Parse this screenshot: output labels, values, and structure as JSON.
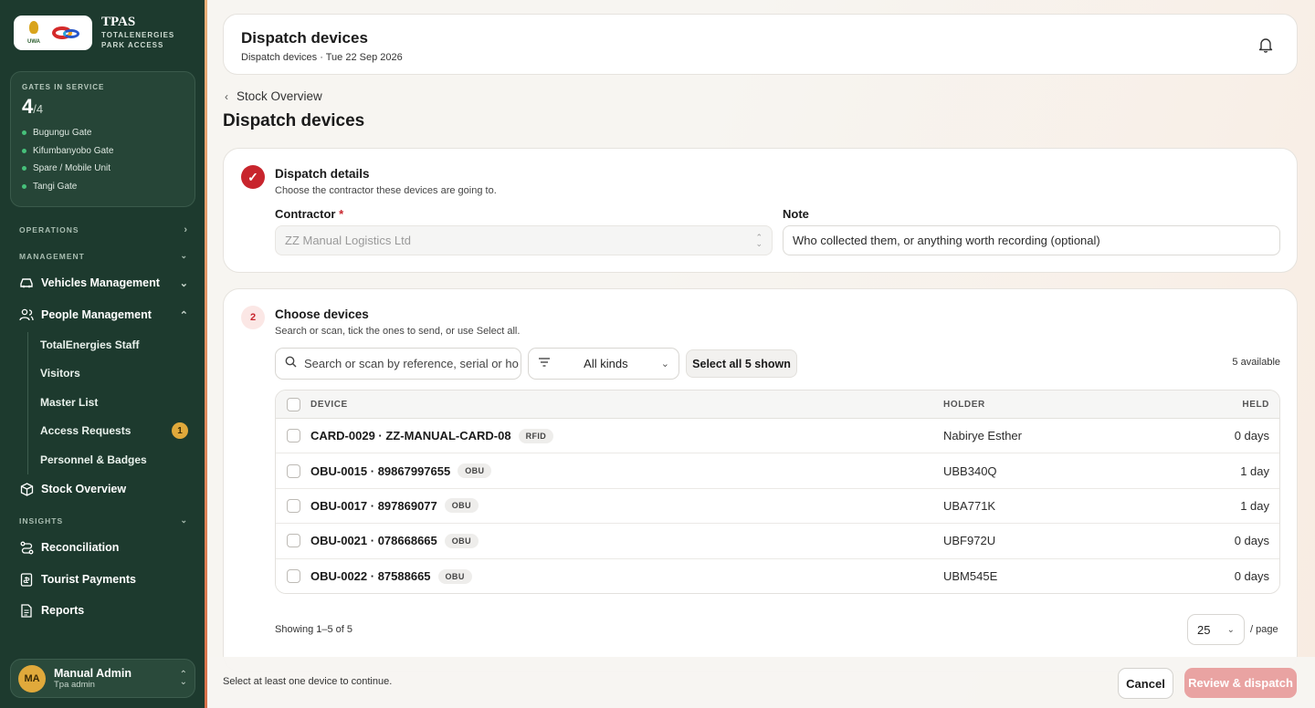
{
  "brand": {
    "title": "TPAS",
    "subtitle_line1": "TOTALENERGIES",
    "subtitle_line2": "PARK ACCESS",
    "logo_text": "UWA"
  },
  "gates": {
    "label": "GATES IN SERVICE",
    "count": "4",
    "total": "/4",
    "items": [
      "Bugungu Gate",
      "Kifumbanyobo Gate",
      "Spare / Mobile Unit",
      "Tangi Gate"
    ],
    "status_color": "#46c07a"
  },
  "nav": {
    "operations": "OPERATIONS",
    "management": "MANAGEMENT",
    "vehicles": "Vehicles Management",
    "people": "People Management",
    "people_sub": [
      "TotalEnergies Staff",
      "Visitors",
      "Master List",
      "Access Requests",
      "Personnel & Badges"
    ],
    "access_requests_badge": "1",
    "stock": "Stock Overview",
    "insights": "INSIGHTS",
    "reconciliation": "Reconciliation",
    "tourist_payments": "Tourist Payments",
    "reports": "Reports"
  },
  "user": {
    "initials": "MA",
    "name": "Manual Admin",
    "role": "Tpa admin"
  },
  "topbar": {
    "title": "Dispatch devices",
    "subtitle": "Dispatch devices · Tue 22 Sep 2026"
  },
  "breadcrumb": {
    "back_label": "Stock Overview"
  },
  "page": {
    "title": "Dispatch devices"
  },
  "dispatch_details": {
    "title": "Dispatch details",
    "subtitle": "Choose the contractor these devices are going to.",
    "contractor_label": "Contractor",
    "required_mark": "*",
    "contractor_value": "ZZ Manual Logistics Ltd",
    "note_label": "Note",
    "note_placeholder": "Who collected them, or anything worth recording (optional)"
  },
  "choose_devices": {
    "step": "2",
    "title": "Choose devices",
    "subtitle": "Search or scan, tick the ones to send, or use Select all.",
    "search_placeholder": "Search or scan by reference, serial or ho",
    "kind_filter": "All kinds",
    "select_all": "Select all 5 shown",
    "available": "5 available",
    "columns": {
      "device": "DEVICE",
      "holder": "HOLDER",
      "held": "HELD"
    },
    "rows": [
      {
        "device": "CARD-0029 · ZZ-MANUAL-CARD-08",
        "tag": "RFID",
        "holder": "Nabirye Esther",
        "held": "0 days"
      },
      {
        "device": "OBU-0015 · 89867997655",
        "tag": "OBU",
        "holder": "UBB340Q",
        "held": "1 day"
      },
      {
        "device": "OBU-0017 · 897869077",
        "tag": "OBU",
        "holder": "UBA771K",
        "held": "1 day"
      },
      {
        "device": "OBU-0021 · 078668665",
        "tag": "OBU",
        "holder": "UBF972U",
        "held": "0 days"
      },
      {
        "device": "OBU-0022 · 87588665",
        "tag": "OBU",
        "holder": "UBM545E",
        "held": "0 days"
      }
    ],
    "showing": "Showing 1–5 of 5",
    "per_page_value": "25",
    "per_page_label": "/ page"
  },
  "footer": {
    "hint": "Select at least one device to continue.",
    "cancel": "Cancel",
    "primary": "Review & dispatch"
  },
  "colors": {
    "sidebar": "#1d3a2e",
    "accent": "#c8252d",
    "primary_disabled": "#e9a3a2"
  }
}
